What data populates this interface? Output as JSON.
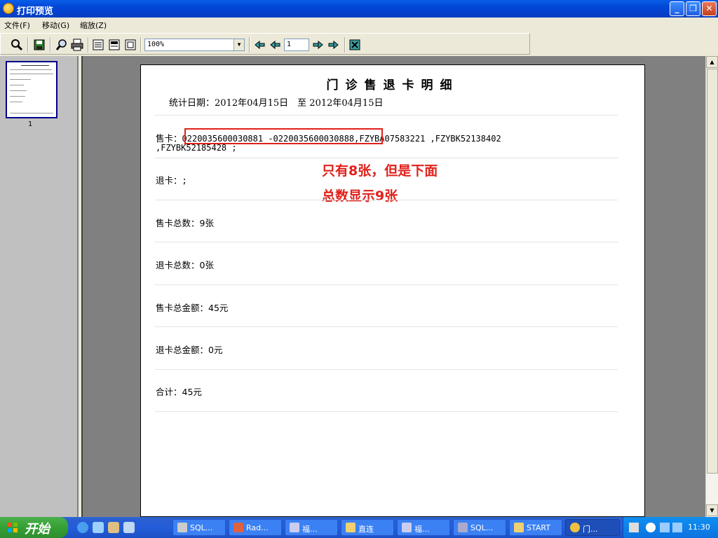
{
  "window": {
    "title": "打印预览",
    "controls": {
      "minimize": "_",
      "maximize": "❐",
      "close": "✕"
    }
  },
  "menu": [
    "文件(F)",
    "移动(G)",
    "缩放(Z)"
  ],
  "toolbar": {
    "zoom_value": "100%",
    "page_value": "1",
    "icons": [
      "zoom-icon",
      "save-icon",
      "find-icon",
      "print-icon",
      "single-page-icon",
      "two-page-icon",
      "fit-page-icon",
      "first-page-icon",
      "prev-page-icon",
      "next-page-icon",
      "last-page-icon",
      "close-preview-icon"
    ]
  },
  "thumbnail": {
    "label": "1"
  },
  "report": {
    "title": "门诊售退卡明细",
    "stat_date": "统计日期：2012年04月15日　至 2012年04月15日",
    "sold_label": "售卡：",
    "sold_line1": "0220035600030881 -0220035600030888,FZYBA07583221 ,FZYBK52138402",
    "sold_line2": ",FZYBK52185428 ;",
    "refund_label": "退卡：",
    "refund_value": ";",
    "sold_total_label": "售卡总数：",
    "sold_total_value": "9张",
    "refund_total_label": "退卡总数：",
    "refund_total_value": "0张",
    "sold_amount_label": "售卡总金额：",
    "sold_amount_value": "45元",
    "refund_amount_label": "退卡总金额：",
    "refund_amount_value": "0元",
    "sum_label": "合计：",
    "sum_value": "45元"
  },
  "annotation": {
    "line1": "只有8张，但是下面",
    "line2": "总数显示9张",
    "color": "#e0201a"
  },
  "taskbar": {
    "start_label": "开始",
    "tasks": [
      {
        "label": "SQL...",
        "active": false
      },
      {
        "label": "Rad...",
        "active": false
      },
      {
        "label": "福...",
        "active": false
      },
      {
        "label": "直连",
        "active": false
      },
      {
        "label": "福...",
        "active": false
      },
      {
        "label": "SQL...",
        "active": false
      },
      {
        "label": "START",
        "active": false
      },
      {
        "label": "门...",
        "active": true
      }
    ],
    "clock": "11:30"
  }
}
